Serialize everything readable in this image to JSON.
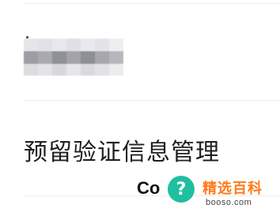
{
  "menu": {
    "verification_info_label": "预留验证信息管理"
  },
  "bottom": {
    "partial_text": "Co"
  },
  "watermark": {
    "icon": "question-mark-icon",
    "badge_glyph": "?",
    "site_name": "精选百科",
    "url": "booso.com",
    "brand_color": "#ff7a1a",
    "badge_color": "#1fbfa0"
  }
}
